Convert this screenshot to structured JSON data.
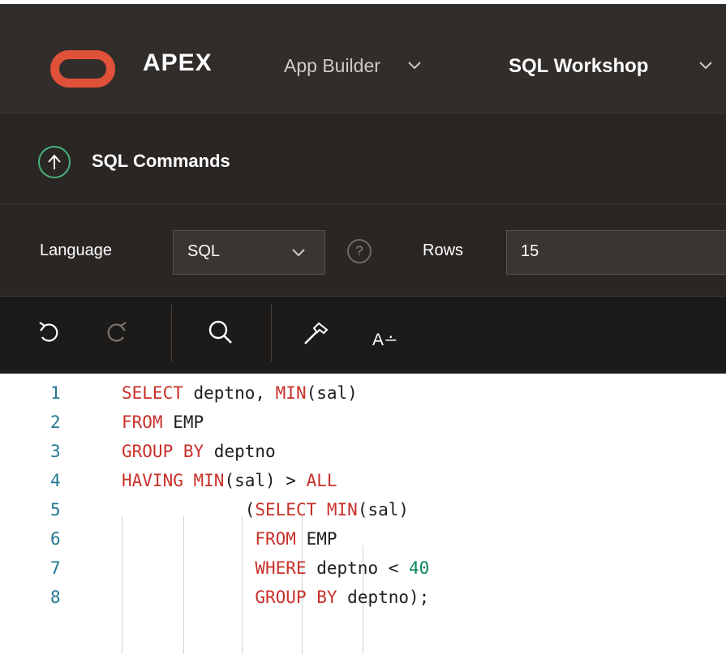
{
  "header": {
    "brand": "APEX",
    "nav": [
      {
        "label": "App Builder"
      },
      {
        "label": "SQL Workshop"
      }
    ]
  },
  "page": {
    "title": "SQL Commands"
  },
  "options": {
    "language_label": "Language",
    "language_value": "SQL",
    "help_glyph": "?",
    "rows_label": "Rows",
    "rows_value": "15"
  },
  "toolbar": {
    "format_label": "A∸"
  },
  "colors": {
    "accent_logo": "#e0513a",
    "keyword": "#c8302a",
    "number": "#098658",
    "line_number": "#237893",
    "up_icon": "#48b37a"
  },
  "editor": {
    "lines": [
      {
        "n": "1",
        "tokens": [
          {
            "t": "SELECT",
            "k": "kw"
          },
          {
            "t": " deptno, "
          },
          {
            "t": "MIN",
            "k": "kw"
          },
          {
            "t": "(sal)"
          }
        ]
      },
      {
        "n": "2",
        "tokens": [
          {
            "t": "FROM",
            "k": "kw"
          },
          {
            "t": " EMP"
          }
        ]
      },
      {
        "n": "3",
        "tokens": [
          {
            "t": "GROUP BY",
            "k": "kw"
          },
          {
            "t": " deptno"
          }
        ]
      },
      {
        "n": "4",
        "tokens": [
          {
            "t": "HAVING",
            "k": "kw"
          },
          {
            "t": " "
          },
          {
            "t": "MIN",
            "k": "kw"
          },
          {
            "t": "(sal) > "
          },
          {
            "t": "ALL",
            "k": "kw"
          }
        ]
      },
      {
        "n": "5",
        "tokens": [
          {
            "t": "            (",
            "k": ""
          },
          {
            "t": "SELECT",
            "k": "kw"
          },
          {
            "t": " "
          },
          {
            "t": "MIN",
            "k": "kw"
          },
          {
            "t": "(sal)"
          }
        ]
      },
      {
        "n": "6",
        "tokens": [
          {
            "t": "             "
          },
          {
            "t": "FROM",
            "k": "kw"
          },
          {
            "t": " EMP"
          }
        ]
      },
      {
        "n": "7",
        "tokens": [
          {
            "t": "             "
          },
          {
            "t": "WHERE",
            "k": "kw"
          },
          {
            "t": " deptno < "
          },
          {
            "t": "40",
            "k": "num"
          }
        ]
      },
      {
        "n": "8",
        "tokens": [
          {
            "t": "             "
          },
          {
            "t": "GROUP BY",
            "k": "kw"
          },
          {
            "t": " deptno);"
          }
        ]
      }
    ]
  }
}
